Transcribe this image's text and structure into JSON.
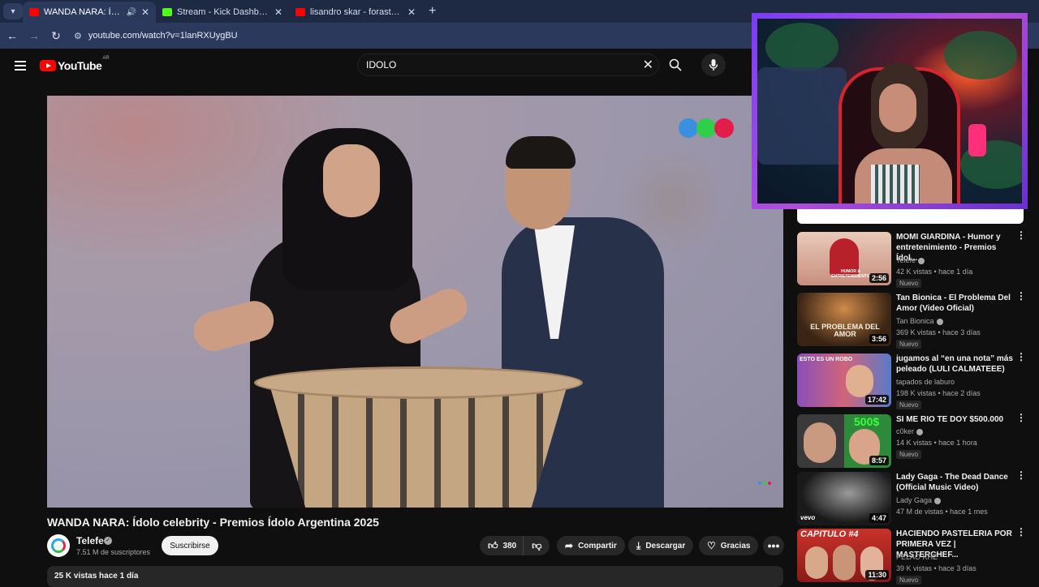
{
  "browser": {
    "tabs": [
      {
        "title": "WANDA NARA: Ídolo celebrity",
        "favicon_color": "#ff0000",
        "active": true
      },
      {
        "title": "Stream - Kick Dashboard",
        "favicon_color": "#53fc18",
        "active": false
      },
      {
        "title": "lisandro skar - forastero (Video",
        "favicon_color": "#ff0000",
        "active": false
      }
    ],
    "new_tab": "+",
    "url": "youtube.com/watch?v=1lanRXUygBU"
  },
  "youtube": {
    "logo_text": "YouTube",
    "logo_country": "AR",
    "search_value": "IDOLO"
  },
  "video": {
    "title": "WANDA NARA: Ídolo celebrity - Premios Ídolo Argentina 2025",
    "channel": "Telefe",
    "subscribers": "7.51 M de suscriptores",
    "subscribe_label": "Suscribirse",
    "likes": "380",
    "share_label": "Compartir",
    "download_label": "Descargar",
    "thanks_label": "Gracias",
    "description": "25 K vistas  hace 1 día"
  },
  "sidebar": {
    "items": [
      {
        "title": "MOMI GIARDINA - Humor y entretenimiento - Premios Ídol...",
        "channel": "Telefe",
        "verified": true,
        "meta": "42 K vistas • hace 1 día",
        "badge": "Nuevo",
        "duration": "2:56",
        "thumb_color": "#c8a394"
      },
      {
        "title": "Tan Bionica - El Problema Del Amor (Video Oficial)",
        "channel": "Tan Bionica",
        "verified": true,
        "meta": "369 K vistas • hace 3 días",
        "badge": "Nuevo",
        "duration": "3:56",
        "thumb_color": "#5a3a22"
      },
      {
        "title": "jugamos al “en una nota” más peleado (LULI CALMATEEE)",
        "channel": "tapados de laburo",
        "verified": false,
        "meta": "198 K vistas • hace 2 días",
        "badge": "Nuevo",
        "duration": "17:42",
        "thumb_color": "#7a4f9a"
      },
      {
        "title": "SI ME RIO TE DOY $500.000",
        "channel": "c0ker",
        "verified": true,
        "meta": "14 K vistas • hace 1 hora",
        "badge": "Nuevo",
        "duration": "8:57",
        "thumb_color": "#4a5a3a"
      },
      {
        "title": "Lady Gaga - The Dead Dance (Official Music Video)",
        "channel": "Lady Gaga",
        "verified": true,
        "meta": "47 M de vistas • hace 1 mes",
        "badge": "",
        "duration": "4:47",
        "thumb_color": "#3a3a3a"
      },
      {
        "title": "HACIENDO PASTELERIA POR PRIMERA VEZ | MASTERCHEF...",
        "channel": "PELAO KHE",
        "verified": false,
        "meta": "39 K vistas • hace 3 días",
        "badge": "Nuevo",
        "duration": "11:30",
        "thumb_color": "#a03028"
      }
    ]
  },
  "thumb_text": {
    "item1": "HUMOR & ENTRETENIMIENTO",
    "item2": "EL PROBLEMA DEL AMOR",
    "item3": "ESTO ES UN ROBO",
    "item4": "500$",
    "item5": "vevo",
    "item6": "CAPITULO #4"
  }
}
